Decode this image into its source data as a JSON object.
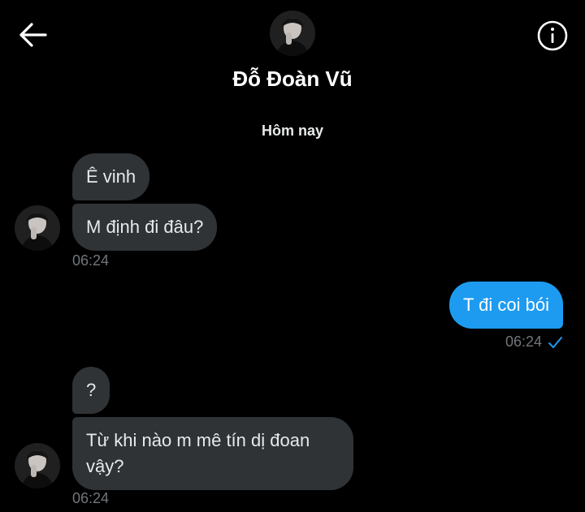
{
  "header": {
    "back_icon": "arrow-left-icon",
    "info_icon": "info-circle-icon",
    "contact_name": "Đỗ Đoàn Vũ"
  },
  "day_separator": "Hôm nay",
  "messages": {
    "group1": {
      "m1": "Ê vinh",
      "m2": "M định đi đâu?",
      "time": "06:24"
    },
    "outgoing": {
      "m1": "T đi coi bói",
      "time": "06:24",
      "status_icon": "checkmark-icon"
    },
    "group2": {
      "m1": "?",
      "m2_line1": "Từ khi nào m mê tín dị đoan",
      "m2_line2": "vậy?",
      "time": "06:24"
    }
  },
  "colors": {
    "background": "#000000",
    "incoming_bubble": "#2f3336",
    "outgoing_bubble": "#1d9bf0",
    "timestamp": "#71767b",
    "read_check": "#1d9bf0"
  }
}
